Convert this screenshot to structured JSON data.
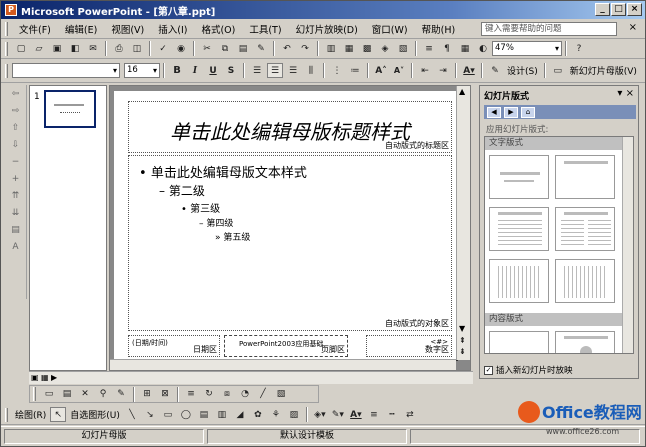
{
  "window": {
    "title": "Microsoft PowerPoint - [第八章.ppt]",
    "logo_letter": "P",
    "buttons": [
      "_",
      "□",
      "×"
    ]
  },
  "menu": {
    "items": [
      "文件(F)",
      "编辑(E)",
      "视图(V)",
      "插入(I)",
      "格式(O)",
      "工具(T)",
      "幻灯片放映(D)",
      "窗口(W)",
      "帮助(H)"
    ],
    "help_placeholder": "键入需要帮助的问题"
  },
  "standard_toolbar": {
    "zoom": "47%"
  },
  "format_toolbar": {
    "font_name": "",
    "font_size": "16",
    "bold": "B",
    "italic": "I",
    "underline": "U",
    "shadow": "S",
    "design_label": "设计(S)",
    "new_slide_label": "新幻灯片母版(V)"
  },
  "thumbnails": {
    "slide_number": "1"
  },
  "slide": {
    "title_text": "单击此处编辑母版标题样式",
    "title_area_label": "自动版式的标题区",
    "body_levels": [
      "单击此处编辑母版文本样式",
      "第二级",
      "第三级",
      "第四级",
      "第五级"
    ],
    "object_area_label": "自动版式的对象区",
    "date_placeholder": "(日期/时间)",
    "date_area_label": "日期区",
    "footer_text": "PowerPoint2003应用基础",
    "footer_area_label": "页脚区",
    "number_placeholder": "<#>",
    "number_area_label": "数字区"
  },
  "task_pane": {
    "title": "幻灯片版式",
    "apply_label": "应用幻灯片版式:",
    "section_text": "文字版式",
    "section_content": "内容版式",
    "show_on_insert_label": "插入新幻灯片时放映"
  },
  "draw_toolbar": {
    "draw_label": "绘图(R)",
    "autoshape_label": "自选图形(U)"
  },
  "status": {
    "view": "幻灯片母版",
    "template": "默认设计模板"
  },
  "watermark": {
    "brand": "Office教程网",
    "url": "www.office26.com"
  }
}
